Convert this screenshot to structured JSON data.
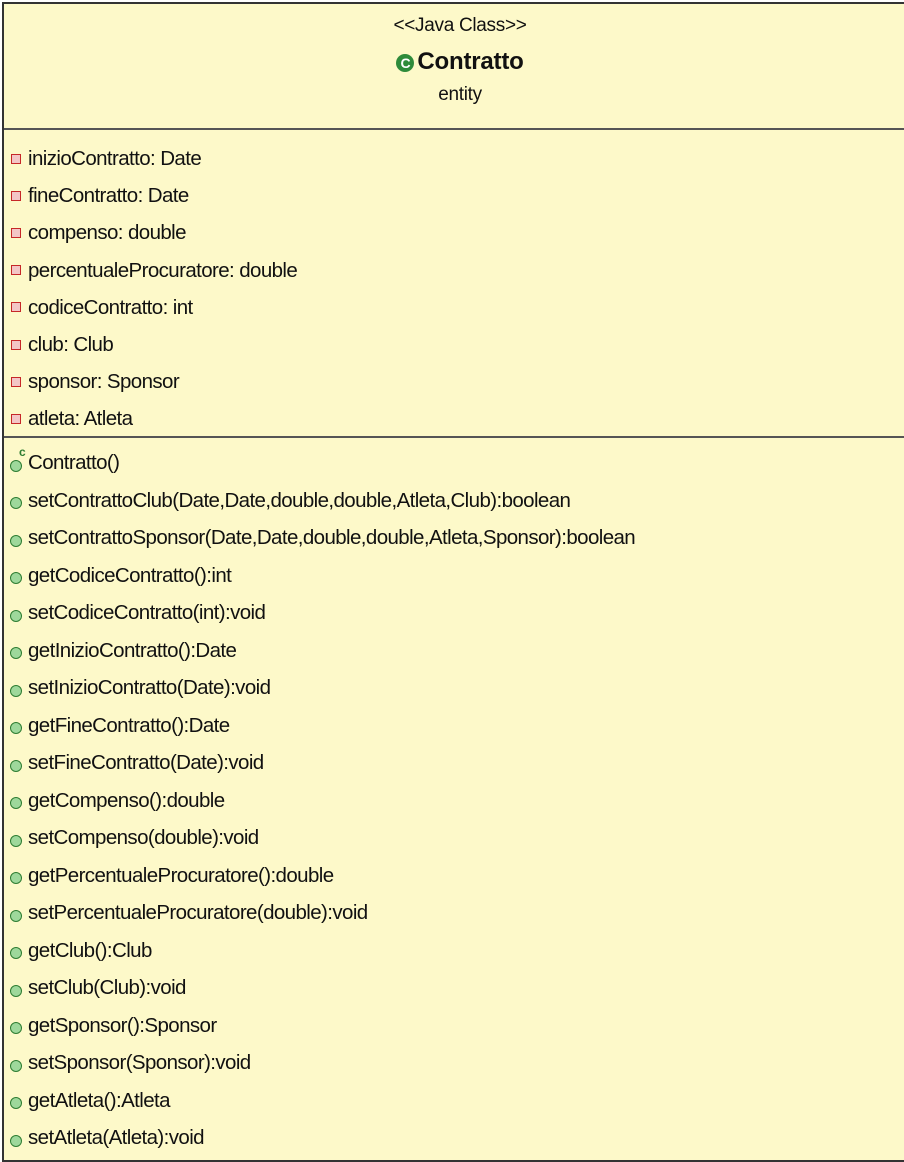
{
  "header": {
    "stereotype": "<<Java Class>>",
    "class_icon": "C",
    "class_name": "Contratto",
    "package": "entity"
  },
  "colors": {
    "fill": "#fdf9c9",
    "private": "#c62828",
    "public": "#2e7d32"
  },
  "attributes": [
    {
      "visibility": "private",
      "text": "inizioContratto: Date"
    },
    {
      "visibility": "private",
      "text": "fineContratto: Date"
    },
    {
      "visibility": "private",
      "text": "compenso: double"
    },
    {
      "visibility": "private",
      "text": "percentualeProcuratore: double"
    },
    {
      "visibility": "private",
      "text": "codiceContratto: int"
    },
    {
      "visibility": "private",
      "text": "club: Club"
    },
    {
      "visibility": "private",
      "text": "sponsor: Sponsor"
    },
    {
      "visibility": "private",
      "text": "atleta: Atleta"
    }
  ],
  "operations": [
    {
      "visibility": "public",
      "constructor": true,
      "constructor_mark": "c",
      "text": "Contratto()"
    },
    {
      "visibility": "public",
      "text": "setContrattoClub(Date,Date,double,double,Atleta,Club):boolean"
    },
    {
      "visibility": "public",
      "text": "setContrattoSponsor(Date,Date,double,double,Atleta,Sponsor):boolean"
    },
    {
      "visibility": "public",
      "text": "getCodiceContratto():int"
    },
    {
      "visibility": "public",
      "text": "setCodiceContratto(int):void"
    },
    {
      "visibility": "public",
      "text": "getInizioContratto():Date"
    },
    {
      "visibility": "public",
      "text": "setInizioContratto(Date):void"
    },
    {
      "visibility": "public",
      "text": "getFineContratto():Date"
    },
    {
      "visibility": "public",
      "text": "setFineContratto(Date):void"
    },
    {
      "visibility": "public",
      "text": "getCompenso():double"
    },
    {
      "visibility": "public",
      "text": "setCompenso(double):void"
    },
    {
      "visibility": "public",
      "text": "getPercentualeProcuratore():double"
    },
    {
      "visibility": "public",
      "text": "setPercentualeProcuratore(double):void"
    },
    {
      "visibility": "public",
      "text": "getClub():Club"
    },
    {
      "visibility": "public",
      "text": "setClub(Club):void"
    },
    {
      "visibility": "public",
      "text": "getSponsor():Sponsor"
    },
    {
      "visibility": "public",
      "text": "setSponsor(Sponsor):void"
    },
    {
      "visibility": "public",
      "text": "getAtleta():Atleta"
    },
    {
      "visibility": "public",
      "text": "setAtleta(Atleta):void"
    }
  ]
}
